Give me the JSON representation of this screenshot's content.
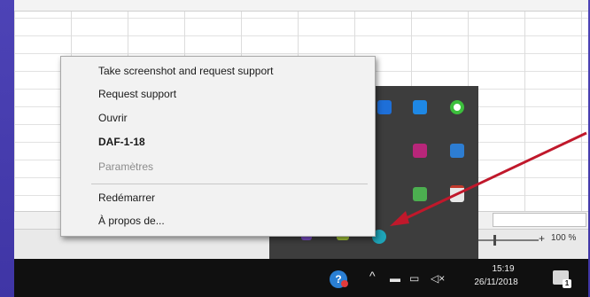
{
  "context_menu": {
    "items": [
      {
        "label": "Take screenshot and request support",
        "style": "normal"
      },
      {
        "label": "Request support",
        "style": "normal"
      },
      {
        "label": "Ouvrir",
        "style": "normal"
      },
      {
        "label": "DAF-1-18",
        "style": "bold"
      },
      {
        "label": "Paramètres",
        "style": "disabled"
      },
      {
        "label": "Redémarrer",
        "style": "normal"
      },
      {
        "label": "À propos de...",
        "style": "normal"
      }
    ]
  },
  "excel_status": {
    "zoom_plus": "+",
    "zoom_label": "100 %"
  },
  "taskbar": {
    "app_icon_text": "?",
    "chevron": "^",
    "time": "15:19",
    "date": "26/11/2018",
    "notification_badge": "1"
  },
  "tray_icons": [
    {
      "name": "blue-square",
      "color": "#1e6fd8"
    },
    {
      "name": "bluetooth",
      "color": "#1e88e5"
    },
    {
      "name": "green-ring",
      "color": "#3cbf3c"
    },
    {
      "name": "magenta-square",
      "color": "#b8267a"
    },
    {
      "name": "blue-app",
      "color": "#2d7dd2"
    },
    {
      "name": "green-square",
      "color": "#4caf50"
    },
    {
      "name": "white-doc",
      "color": "#e8e8e8"
    },
    {
      "name": "purple-small",
      "color": "#7a4dc6"
    },
    {
      "name": "yellow-green",
      "color": "#a4c639"
    },
    {
      "name": "teal-support",
      "color": "#1ea4b8"
    }
  ],
  "accent_colors": {
    "arrow": "#c0182b",
    "taskbar": "#101010",
    "tray": "#3d3d3d"
  }
}
